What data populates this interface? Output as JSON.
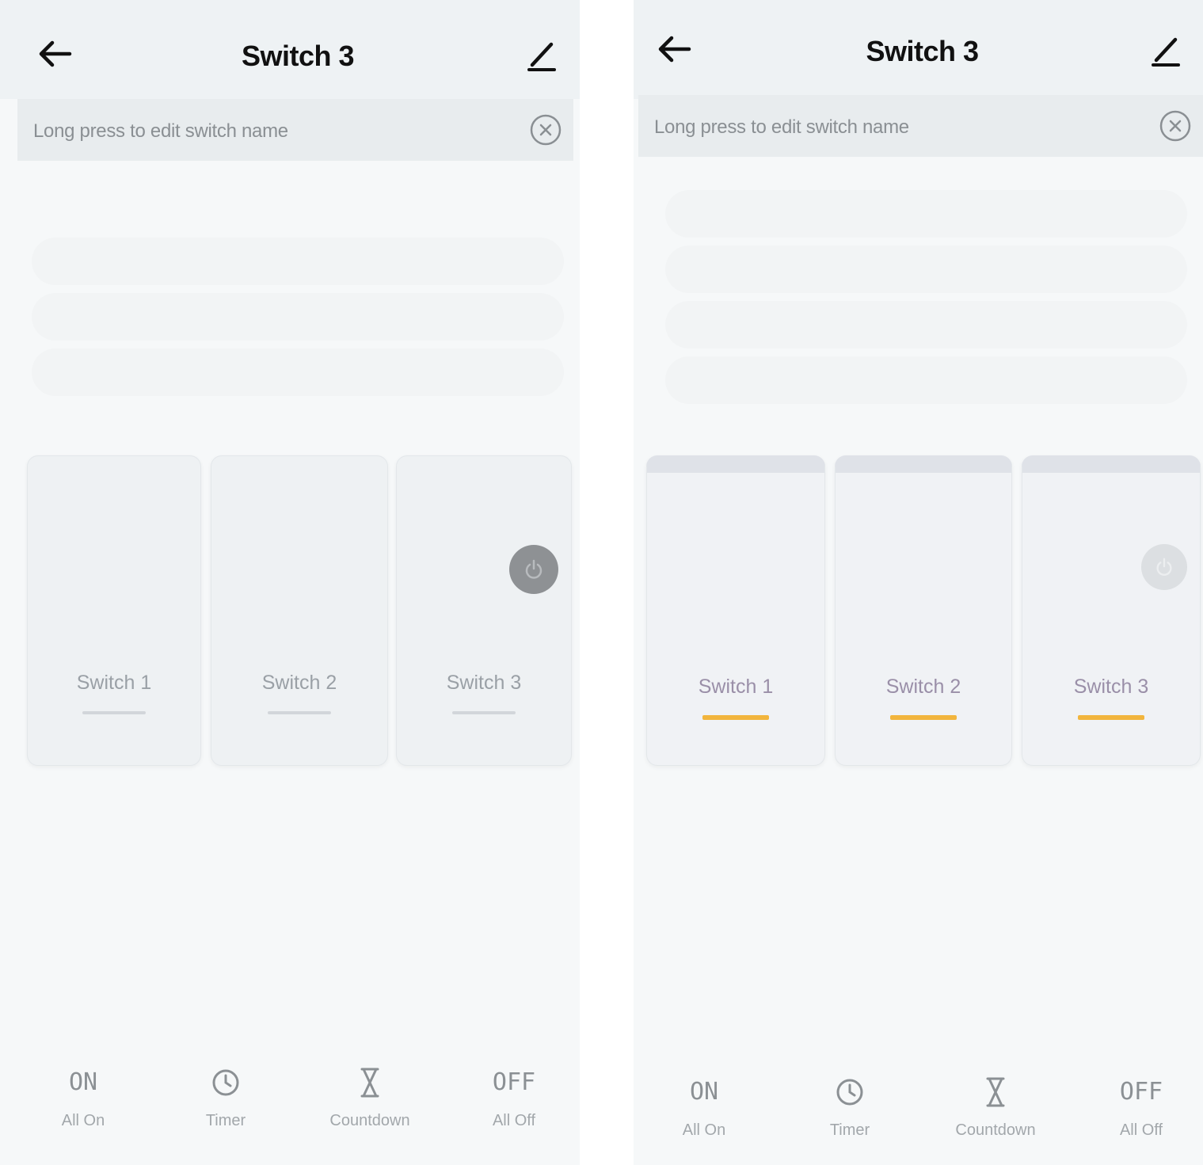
{
  "screens": [
    {
      "title": "Switch 3",
      "hint": "Long press to edit switch name",
      "switches": [
        {
          "label": "Switch 1"
        },
        {
          "label": "Switch 2"
        },
        {
          "label": "Switch 3"
        }
      ],
      "actions": [
        {
          "icon_text": "ON",
          "label": "All On"
        },
        {
          "icon_text": "",
          "label": "Timer"
        },
        {
          "icon_text": "",
          "label": "Countdown"
        },
        {
          "icon_text": "OFF",
          "label": "All Off"
        }
      ]
    },
    {
      "title": "Switch 3",
      "hint": "Long press to edit switch name",
      "switches": [
        {
          "label": "Switch 1"
        },
        {
          "label": "Switch 2"
        },
        {
          "label": "Switch 3"
        }
      ],
      "actions": [
        {
          "icon_text": "ON",
          "label": "All On"
        },
        {
          "icon_text": "",
          "label": "Timer"
        },
        {
          "icon_text": "",
          "label": "Countdown"
        },
        {
          "icon_text": "OFF",
          "label": "All Off"
        }
      ]
    }
  ],
  "colors": {
    "indicator_on": "#f2b53d",
    "indicator_off": "#d2d6da"
  }
}
